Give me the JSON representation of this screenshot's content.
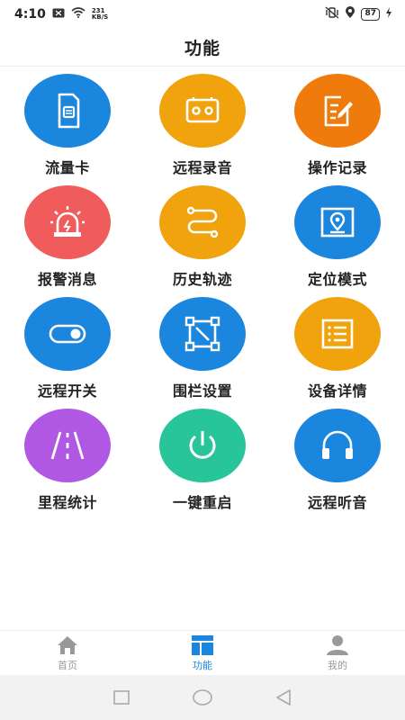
{
  "status_bar": {
    "time": "4:10",
    "net_speed_value": "231",
    "net_speed_unit": "KB/S",
    "battery": "87"
  },
  "title": "功能",
  "grid": [
    {
      "label": "流量卡",
      "icon": "sim-card-icon",
      "color": "#1b86dd"
    },
    {
      "label": "远程录音",
      "icon": "cassette-icon",
      "color": "#f0a30c"
    },
    {
      "label": "操作记录",
      "icon": "edit-record-icon",
      "color": "#ef7b0d"
    },
    {
      "label": "报警消息",
      "icon": "alarm-light-icon",
      "color": "#f05c5c"
    },
    {
      "label": "历史轨迹",
      "icon": "track-route-icon",
      "color": "#f0a30c"
    },
    {
      "label": "定位模式",
      "icon": "location-map-icon",
      "color": "#1b86dd"
    },
    {
      "label": "远程开关",
      "icon": "toggle-icon",
      "color": "#1b86dd"
    },
    {
      "label": "围栏设置",
      "icon": "fence-icon",
      "color": "#1b86dd"
    },
    {
      "label": "设备详情",
      "icon": "list-details-icon",
      "color": "#f0a30c"
    },
    {
      "label": "里程统计",
      "icon": "road-icon",
      "color": "#b057e3"
    },
    {
      "label": "一键重启",
      "icon": "power-icon",
      "color": "#28c49a"
    },
    {
      "label": "远程听音",
      "icon": "headphones-icon",
      "color": "#1b86dd"
    }
  ],
  "bottom_nav": [
    {
      "label": "首页",
      "icon": "home-icon",
      "active": false
    },
    {
      "label": "功能",
      "icon": "function-icon",
      "active": true
    },
    {
      "label": "我的",
      "icon": "profile-icon",
      "active": false
    }
  ],
  "colors": {
    "active": "#1b86dd",
    "inactive": "#999999"
  }
}
